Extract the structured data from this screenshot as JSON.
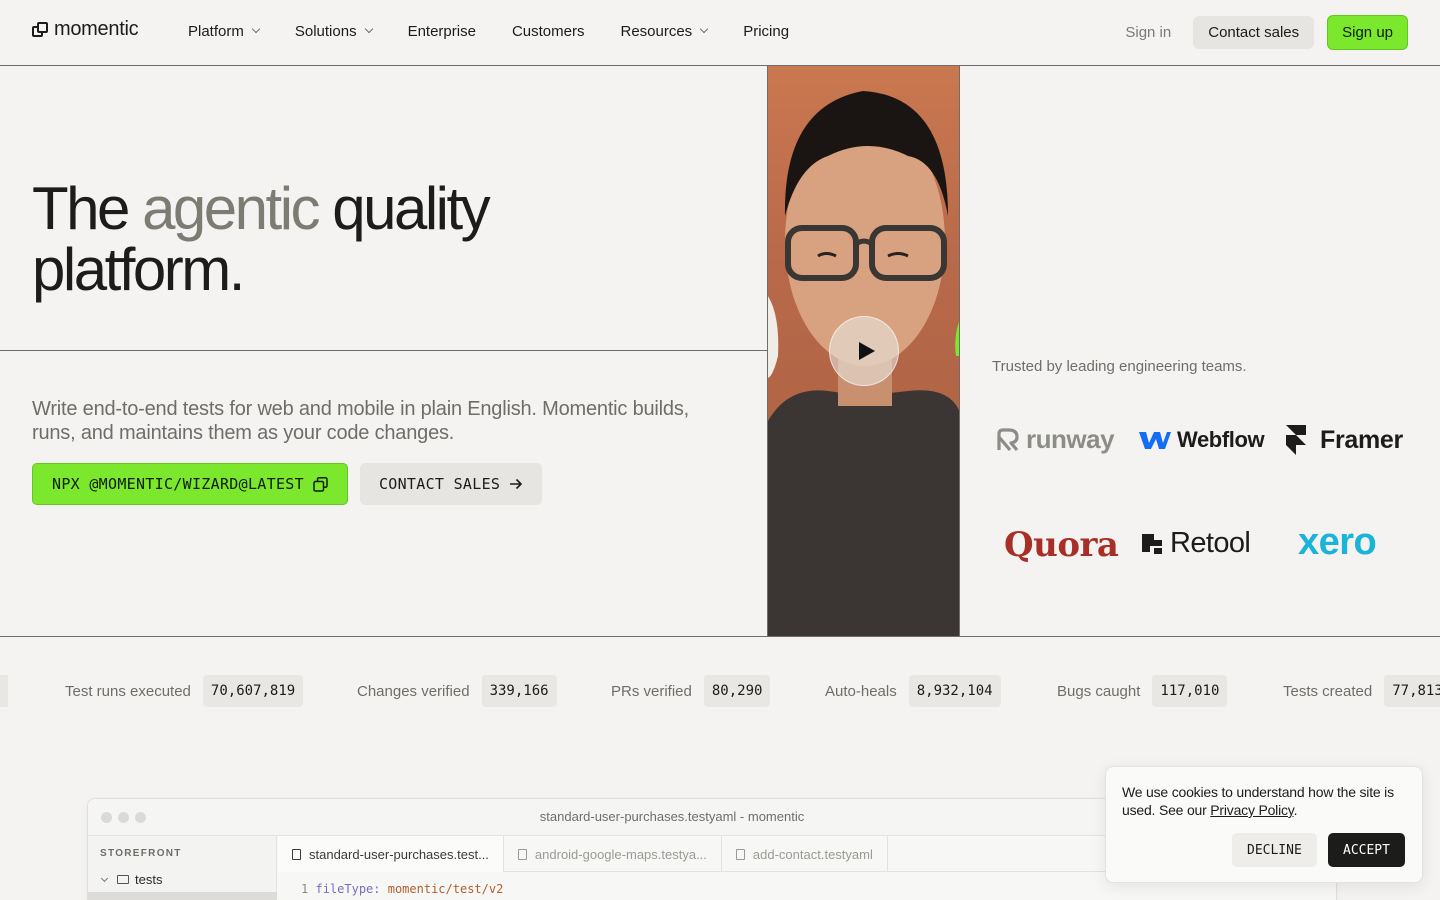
{
  "nav": {
    "logo_text": "momentic",
    "links": [
      {
        "label": "Platform",
        "has_dropdown": true
      },
      {
        "label": "Solutions",
        "has_dropdown": true
      },
      {
        "label": "Enterprise",
        "has_dropdown": false
      },
      {
        "label": "Customers",
        "has_dropdown": false
      },
      {
        "label": "Resources",
        "has_dropdown": true
      },
      {
        "label": "Pricing",
        "has_dropdown": false
      }
    ],
    "sign_in": "Sign in",
    "contact_sales": "Contact sales",
    "sign_up": "Sign up"
  },
  "hero": {
    "title_part1": "The",
    "title_accent": "agentic",
    "title_part2": "quality",
    "title_line2": "platform.",
    "subtitle": "Write end-to-end tests for web and mobile in plain English. Momentic builds, runs, and maintains them as your code changes.",
    "cta_primary": "NPX @MOMENTIC/WIZARD@LATEST",
    "cta_secondary": "CONTACT SALES"
  },
  "video": {
    "play_icon": "play-icon"
  },
  "trusted": {
    "heading": "Trusted by leading engineering teams.",
    "logos": [
      "runway",
      "Webflow",
      "Framer",
      "Quora",
      "Retool",
      "xero"
    ]
  },
  "stats": [
    {
      "label": "Test runs executed",
      "value": "70,607,819"
    },
    {
      "label": "Changes verified",
      "value": "339,166"
    },
    {
      "label": "PRs verified",
      "value": "80,290"
    },
    {
      "label": "Auto-heals",
      "value": "8,932,104"
    },
    {
      "label": "Bugs caught",
      "value": "117,010"
    },
    {
      "label": "Tests created",
      "value": "77,813"
    }
  ],
  "editor": {
    "window_title": "standard-user-purchases.testyaml - momentic",
    "sidebar_heading": "STOREFRONT",
    "sidebar_folder": "tests",
    "tabs": [
      "standard-user-purchases.test...",
      "android-google-maps.testya...",
      "add-contact.testyaml"
    ],
    "code_line_number": "1",
    "code_key": "fileType:",
    "code_value": "momentic/test/v2"
  },
  "cookie": {
    "text_before_link": "We use cookies to understand how the site is used. See our ",
    "link_text": "Privacy Policy",
    "text_after_link": ".",
    "decline": "DECLINE",
    "accept": "ACCEPT"
  },
  "colors": {
    "brand_green": "#7be82d",
    "background": "#f4f3f1",
    "accent_text": "#7c7c72"
  }
}
